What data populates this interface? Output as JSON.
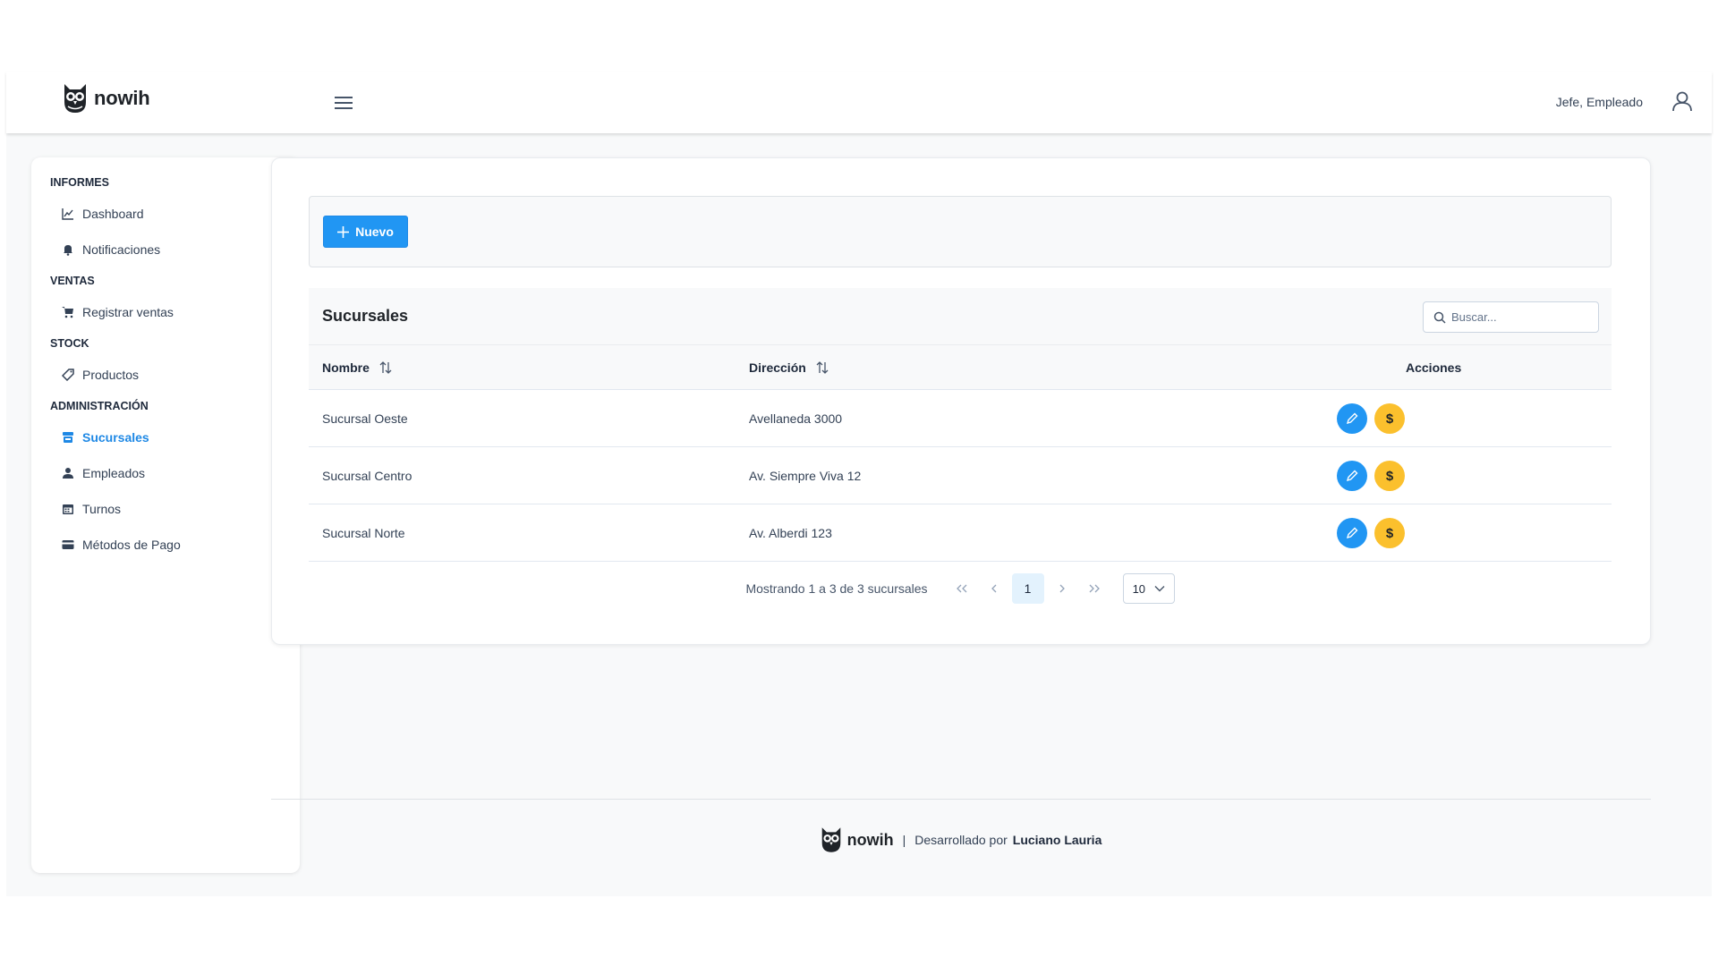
{
  "brand": {
    "name": "nowih"
  },
  "header": {
    "user_label": "Jefe, Empleado"
  },
  "sidebar": {
    "sections": [
      {
        "label": "INFORMES",
        "items": [
          {
            "label": "Dashboard",
            "icon": "chart-line-icon",
            "active": false
          },
          {
            "label": "Notificaciones",
            "icon": "bell-icon",
            "active": false
          }
        ]
      },
      {
        "label": "VENTAS",
        "items": [
          {
            "label": "Registrar ventas",
            "icon": "cart-icon",
            "active": false
          }
        ]
      },
      {
        "label": "STOCK",
        "items": [
          {
            "label": "Productos",
            "icon": "tag-icon",
            "active": false
          }
        ]
      },
      {
        "label": "ADMINISTRACIÓN",
        "items": [
          {
            "label": "Sucursales",
            "icon": "store-icon",
            "active": true
          },
          {
            "label": "Empleados",
            "icon": "user-icon",
            "active": false
          },
          {
            "label": "Turnos",
            "icon": "calendar-icon",
            "active": false
          },
          {
            "label": "Métodos de Pago",
            "icon": "credit-card-icon",
            "active": false
          }
        ]
      }
    ]
  },
  "toolbar": {
    "new_label": "Nuevo"
  },
  "table": {
    "title": "Sucursales",
    "search_placeholder": "Buscar...",
    "columns": [
      "Nombre",
      "Dirección",
      "Acciones"
    ],
    "rows": [
      {
        "nombre": "Sucursal Oeste",
        "direccion": "Avellaneda 3000"
      },
      {
        "nombre": "Sucursal Centro",
        "direccion": "Av. Siempre Viva 12"
      },
      {
        "nombre": "Sucursal Norte",
        "direccion": "Av. Alberdi 123"
      }
    ],
    "pay_symbol": "$"
  },
  "pagination": {
    "info": "Mostrando 1 a 3 de 3 sucursales",
    "current_page": "1",
    "rows_per_page": "10"
  },
  "footer": {
    "developed_by": "Desarrollado por",
    "author": "Luciano Lauria",
    "separator": "|"
  },
  "colors": {
    "primary": "#2196f3",
    "warning": "#fbc02d",
    "active_menu": "#1e88e5"
  }
}
